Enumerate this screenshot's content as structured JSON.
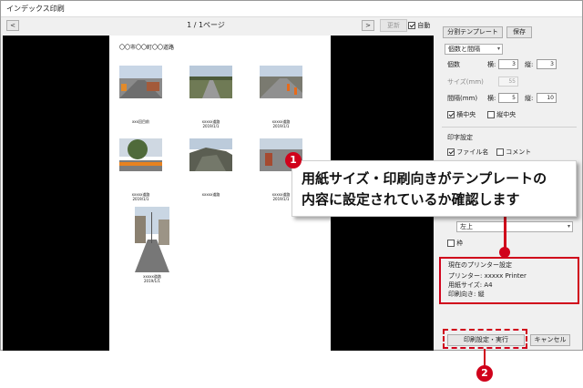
{
  "window": {
    "title": "インデックス印刷"
  },
  "toolbar": {
    "prev_label": "<",
    "next_label": ">",
    "page_indicator": "1 / 1ページ",
    "refresh_label": "更新",
    "auto_label": "自動",
    "auto_checked": true
  },
  "paper": {
    "title": "〇〇市〇〇町〇〇道路",
    "photos": [
      {
        "caption_line1": "xxx回目前",
        "caption_line2": ""
      },
      {
        "caption_line1": "xxxxx道路",
        "caption_line2": "2019/1/1"
      },
      {
        "caption_line1": "xxxxx道路",
        "caption_line2": "2019/1/1"
      },
      {
        "caption_line1": "xxxxx道路",
        "caption_line2": "2019/1/1"
      },
      {
        "caption_line1": "xxxxx道路",
        "caption_line2": ""
      },
      {
        "caption_line1": "xxxxx道路",
        "caption_line2": "2019/1/1"
      },
      {
        "caption_line1": "xxxxx道路",
        "caption_line2": "2019/1/1"
      }
    ]
  },
  "panel": {
    "template_btn": "分割テンプレート",
    "save_btn": "保存",
    "layout_select": "個数と間隔",
    "count_label": "個数",
    "horiz_label": "横:",
    "horiz_count": "3",
    "vert_label": "縦:",
    "vert_count": "3",
    "size_label": "サイズ(mm)",
    "size_value": "55",
    "gap_label": "間隔(mm)",
    "gap_horiz_label": "横:",
    "gap_horiz": "5",
    "gap_vert_label": "縦:",
    "gap_vert": "10",
    "center_h_label": "横中央",
    "center_v_label": "縦中央",
    "print_settings_label": "印字設定",
    "filename_label": "ファイル名",
    "comment_label": "コメント",
    "position_select": "左上",
    "frame_label": "枠"
  },
  "printer": {
    "heading": "現在のプリンター設定",
    "printer_label": "プリンター:",
    "printer_value": "xxxxx Printer",
    "paper_size_label": "用紙サイズ:",
    "paper_size_value": "A4",
    "orientation_label": "印刷向き:",
    "orientation_value": "縦"
  },
  "footer": {
    "print_btn": "印刷設定・実行",
    "cancel_btn": "キャンセル"
  },
  "annotations": {
    "badge1": "1",
    "badge2": "2",
    "callout_line1": "用紙サイズ・印刷向きがテンプレートの",
    "callout_line2": "内容に設定されているか確認します"
  },
  "colors": {
    "accent_red": "#d0021b",
    "preview_bg": "#000000"
  }
}
